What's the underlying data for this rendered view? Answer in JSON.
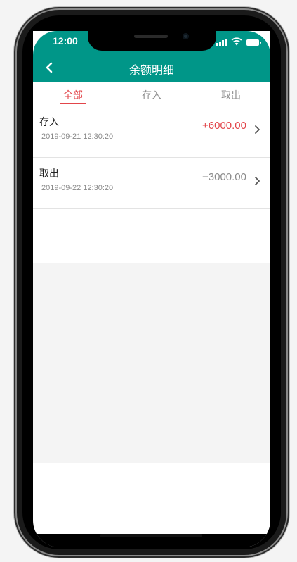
{
  "status_bar": {
    "time": "12:00"
  },
  "navbar": {
    "title": "余额明细",
    "back_icon": "chevron-left-icon"
  },
  "tabs": [
    {
      "label": "全部",
      "active": true
    },
    {
      "label": "存入",
      "active": false
    },
    {
      "label": "取出",
      "active": false
    }
  ],
  "transactions": [
    {
      "title": "存入",
      "datetime": "2019-09-21 12:30:20",
      "amount": "+6000.00",
      "color": "#e2454a"
    },
    {
      "title": "取出",
      "datetime": "2019-09-22 12:30:20",
      "amount": "−3000.00",
      "color": "#8a8a8a"
    }
  ],
  "colors": {
    "header": "#009688",
    "accent": "#e2454a"
  }
}
